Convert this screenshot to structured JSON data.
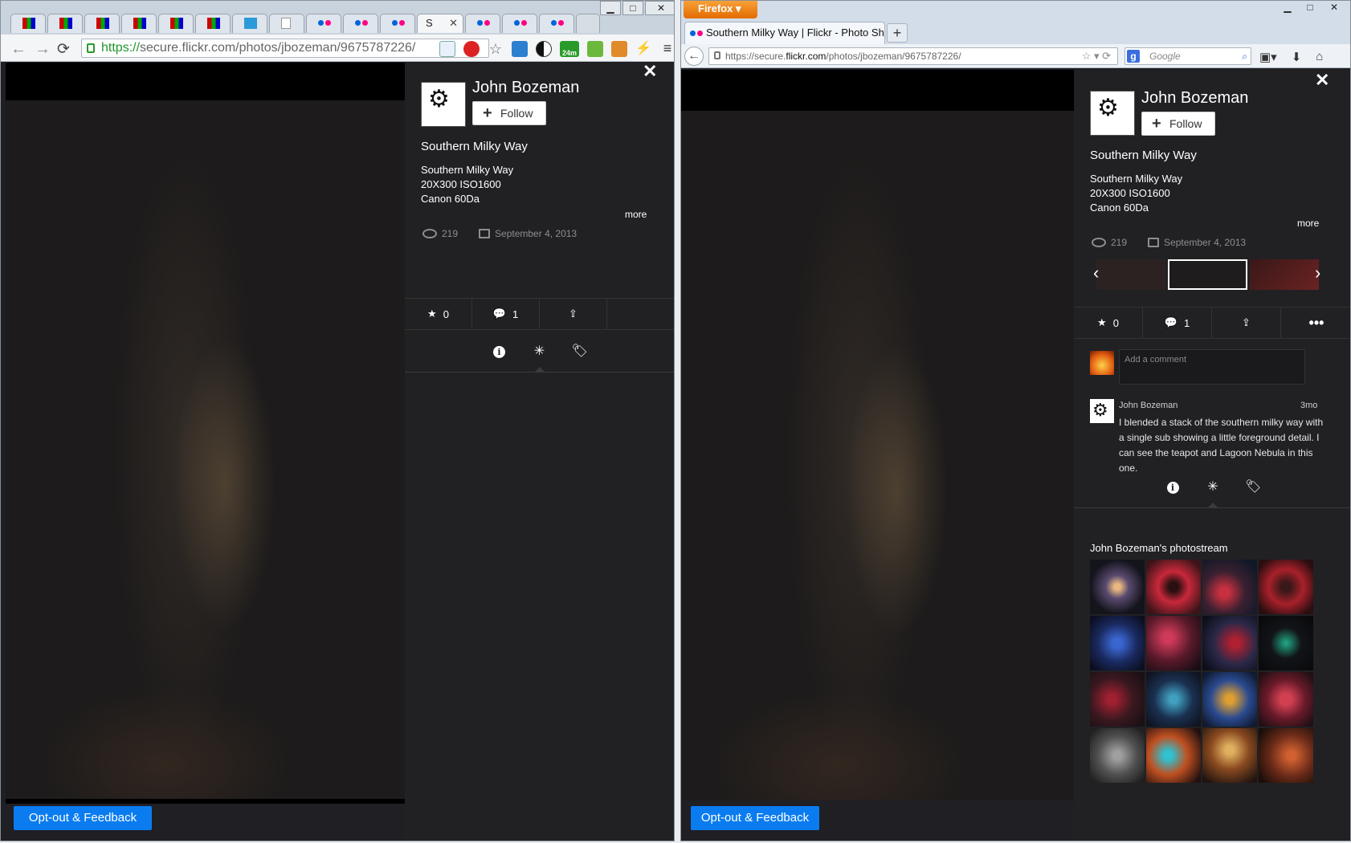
{
  "left_window": {
    "chrome": {
      "tab_active_label": "S",
      "url_scheme": "https://",
      "url_rest": "secure.flickr.com/photos/jbozeman/9675787226/",
      "extension_badge": "24m"
    },
    "panel": {
      "owner_name": "John Bozeman",
      "follow_label": "Follow",
      "photo_title": "Southern Milky Way",
      "description": [
        "Southern Milky Way",
        "20X300 ISO1600",
        "Canon 60Da"
      ],
      "more_label": "more",
      "views": "219",
      "date": "September 4, 2013",
      "faves": "0",
      "comments": "1"
    },
    "opt_out_label": "Opt-out & Feedback"
  },
  "right_window": {
    "firefox": {
      "app_button": "Firefox",
      "tab_title": "Southern Milky Way | Flickr - Photo Shar...",
      "url_prefix": "https://secure.",
      "url_domain": "flickr.com",
      "url_rest": "/photos/jbozeman/9675787226/",
      "search_placeholder": "Google"
    },
    "panel": {
      "owner_name": "John Bozeman",
      "follow_label": "Follow",
      "photo_title": "Southern Milky Way",
      "description": [
        "Southern Milky Way",
        "20X300 ISO1600",
        "Canon 60Da"
      ],
      "more_label": "more",
      "views": "219",
      "date": "September 4, 2013",
      "faves": "0",
      "comments": "1",
      "comment_placeholder": "Add a comment",
      "comment": {
        "author": "John Bozeman",
        "time": "3mo",
        "text": "I blended a stack of the southern milky way with a single sub showing a little foreground detail. I can see the teapot and Lagoon Nebula in this one."
      },
      "photostream_title": "John Bozeman's photostream"
    },
    "opt_out_label": "Opt-out & Feedback"
  },
  "colors": {
    "flickr_blue": "#0a7cf0",
    "panel_bg": "#212124",
    "flickr_pink": "#ff0084",
    "flickr_blue_dot": "#0063dc"
  },
  "icons": [
    "star-icon",
    "comment-icon",
    "share-icon",
    "more-icon",
    "info-icon",
    "sparkle-icon",
    "tag-icon",
    "eye-icon",
    "calendar-icon",
    "close-icon"
  ]
}
